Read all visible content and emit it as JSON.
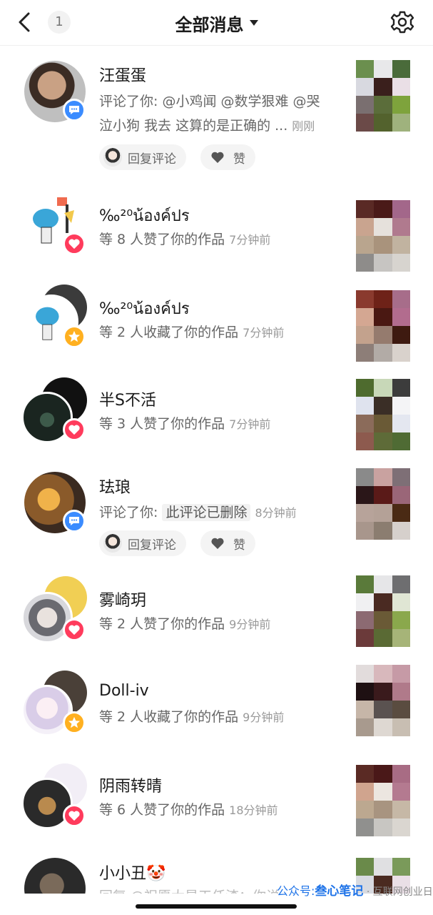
{
  "header": {
    "title": "全部消息",
    "unread_count": "1",
    "back_icon": "chevron-left-icon",
    "settings_icon": "gear-icon"
  },
  "colors": {
    "like": "#ff3b5c",
    "favorite": "#ffb020",
    "comment": "#3b8cff",
    "accent_watermark": "#1e73e8"
  },
  "messages": [
    {
      "name": "汪蛋蛋",
      "type": "comment",
      "line1": "评论了你: @小鸡闻 @数学狠难 @哭",
      "line2": "泣小狗 我去 这算的是正确的 ...",
      "time": "刚刚",
      "reply_label": "回复评论",
      "like_label": "赞"
    },
    {
      "name": "‰²⁰น้องค์ปร",
      "type": "like",
      "text": "等 8 人赞了你的作品",
      "time": "7分钟前"
    },
    {
      "name": "‰²⁰น้องค์ปร",
      "type": "favorite",
      "text": "等 2 人收藏了你的作品",
      "time": "7分钟前"
    },
    {
      "name": "半S不活",
      "type": "like",
      "text": "等 3 人赞了你的作品",
      "time": "7分钟前"
    },
    {
      "name": "珐琅",
      "type": "comment",
      "line1_prefix": "评论了你:",
      "deleted": "此评论已删除",
      "time": "8分钟前",
      "reply_label": "回复评论",
      "like_label": "赞"
    },
    {
      "name": "雾崎玥",
      "type": "like",
      "text": "等 2 人赞了你的作品",
      "time": "9分钟前"
    },
    {
      "name": "Doll-iv",
      "type": "favorite",
      "text": "等 2 人收藏了你的作品",
      "time": "9分钟前"
    },
    {
      "name": "阴雨转晴",
      "type": "like",
      "text": "等 6 人赞了你的作品",
      "time": "18分钟前"
    },
    {
      "name": "小小丑🤡",
      "type": "comment",
      "partial_line": "回复 @祝愿大星工任渣：你说"
    }
  ],
  "watermark": {
    "prefix": "公众号:",
    "brand": "叁心笔记",
    "suffix": "· 互联网创业日记"
  }
}
